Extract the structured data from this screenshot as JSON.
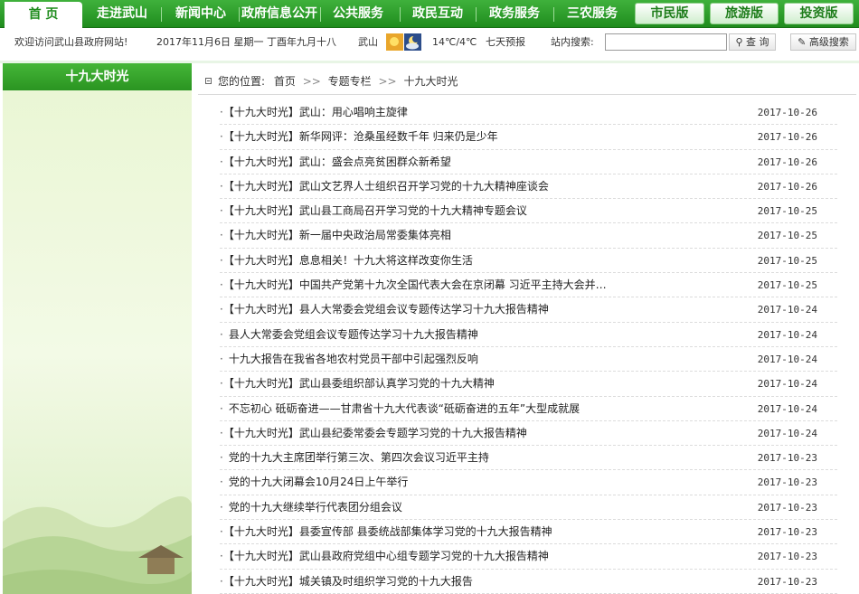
{
  "nav": {
    "items": [
      "首 页",
      "走进武山",
      "新闻中心",
      "政府信息公开",
      "公共服务",
      "政民互动",
      "政务服务",
      "三农服务"
    ],
    "versions": [
      "市民版",
      "旅游版",
      "投资版"
    ]
  },
  "infobar": {
    "welcome": "欢迎访问武山县政府网站!",
    "date": "2017年11月6日  星期一  丁酉年九月十八",
    "city": "武山",
    "temp": "14℃/4℃",
    "forecast": "七天预报",
    "search_label": "站内搜索:",
    "search_value": "",
    "search_button": "查 询",
    "advanced_button": "高级搜索"
  },
  "sidebar": {
    "title": "十九大时光"
  },
  "breadcrumb": {
    "label": "您的位置:",
    "items": [
      "首页",
      "专题专栏",
      "十九大时光"
    ]
  },
  "news": [
    {
      "title": "【十九大时光】武山：用心唱响主旋律",
      "date": "2017-10-26"
    },
    {
      "title": "【十九大时光】新华网评：沧桑虽经数千年 归来仍是少年",
      "date": "2017-10-26"
    },
    {
      "title": "【十九大时光】武山：盛会点亮贫困群众新希望",
      "date": "2017-10-26"
    },
    {
      "title": "【十九大时光】武山文艺界人士组织召开学习党的十九大精神座谈会",
      "date": "2017-10-26"
    },
    {
      "title": "【十九大时光】武山县工商局召开学习党的十九大精神专题会议",
      "date": "2017-10-25"
    },
    {
      "title": "【十九大时光】新一届中央政治局常委集体亮相",
      "date": "2017-10-25"
    },
    {
      "title": "【十九大时光】息息相关！十九大将这样改变你生活",
      "date": "2017-10-25"
    },
    {
      "title": "【十九大时光】中国共产党第十九次全国代表大会在京闭幕 习近平主持大会并…",
      "date": "2017-10-25"
    },
    {
      "title": "【十九大时光】县人大常委会党组会议专题传达学习十九大报告精神",
      "date": "2017-10-24"
    },
    {
      "title": "县人大常委会党组会议专题传达学习十九大报告精神",
      "date": "2017-10-24"
    },
    {
      "title": "十九大报告在我省各地农村党员干部中引起强烈反响",
      "date": "2017-10-24"
    },
    {
      "title": "【十九大时光】武山县委组织部认真学习党的十九大精神",
      "date": "2017-10-24"
    },
    {
      "title": "不忘初心 砥砺奋进——甘肃省十九大代表谈“砥砺奋进的五年”大型成就展",
      "date": "2017-10-24"
    },
    {
      "title": "【十九大时光】武山县纪委常委会专题学习党的十九大报告精神",
      "date": "2017-10-24"
    },
    {
      "title": "党的十九大主席团举行第三次、第四次会议习近平主持",
      "date": "2017-10-23"
    },
    {
      "title": "党的十九大闭幕会10月24日上午举行",
      "date": "2017-10-23"
    },
    {
      "title": "党的十九大继续举行代表团分组会议",
      "date": "2017-10-23"
    },
    {
      "title": "【十九大时光】县委宣传部 县委统战部集体学习党的十九大报告精神",
      "date": "2017-10-23"
    },
    {
      "title": "【十九大时光】武山县政府党组中心组专题学习党的十九大报告精神",
      "date": "2017-10-23"
    },
    {
      "title": "【十九大时光】城关镇及时组织学习党的十九大报告",
      "date": "2017-10-23"
    }
  ]
}
